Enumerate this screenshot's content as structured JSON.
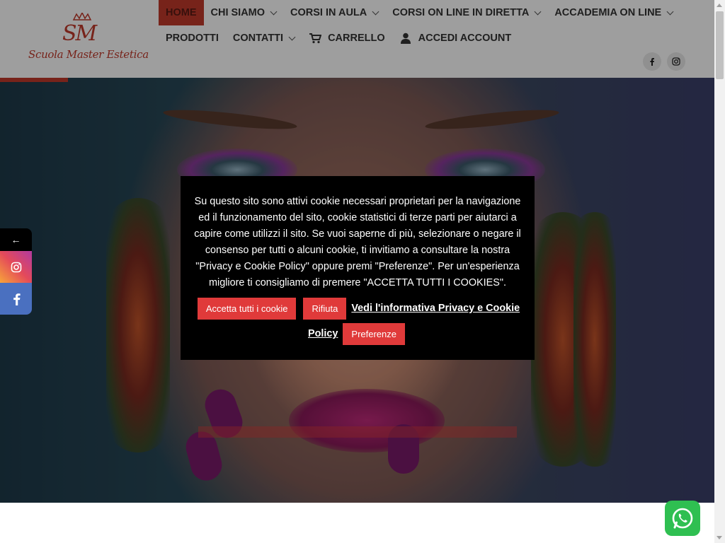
{
  "header": {
    "logo_monogram": "SM",
    "logo_text": "Scuola Master Estetica",
    "nav_row1": [
      {
        "label": "HOME",
        "active": true,
        "dropdown": false
      },
      {
        "label": "CHI SIAMO",
        "active": false,
        "dropdown": true
      },
      {
        "label": "CORSI IN AULA",
        "active": false,
        "dropdown": true
      },
      {
        "label": "CORSI ON LINE IN DIRETTA",
        "active": false,
        "dropdown": true
      },
      {
        "label": "ACCADEMIA ON LINE",
        "active": false,
        "dropdown": true
      }
    ],
    "nav_row2": [
      {
        "label": "PRODOTTI",
        "dropdown": false
      },
      {
        "label": "CONTATTI",
        "dropdown": true
      },
      {
        "label": "CARRELLO",
        "icon": "cart-icon"
      },
      {
        "label": "ACCEDI ACCOUNT",
        "icon": "user-icon"
      }
    ],
    "social": [
      "facebook-icon",
      "instagram-icon"
    ]
  },
  "cookie_banner": {
    "text": "Su questo sito sono attivi cookie necessari proprietari per la navigazione ed il funzionamento del sito, cookie statistici di terze parti per aiutarci a capire come utilizzi il sito. Se vuoi saperne di più, selezionare o negare il consenso per tutti o alcuni cookie, ti invitiamo a consultare la nostra \"Privacy e Cookie Policy\" oppure premi \"Preferenze\". Per un'esperienza migliore ti consigliamo di premere \"ACCETTA TUTTI I COOKIES\".",
    "accept_all": "Accetta tutti i cookie",
    "reject": "Rifiuta",
    "policy_link": "Vedi l'informativa Privacy e Cookie Policy",
    "preferences": "Preferenze"
  },
  "side_social": {
    "back": "←",
    "items": [
      "instagram-icon",
      "facebook-icon"
    ]
  },
  "colors": {
    "accent": "#c0392b",
    "button_red": "#e03a3a",
    "whatsapp": "#2fbf51",
    "facebook": "#4a70c0"
  }
}
